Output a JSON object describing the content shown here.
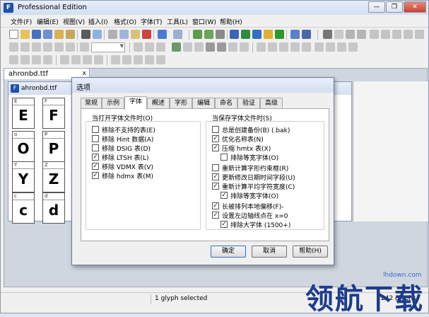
{
  "app": {
    "title": "Professional Edition",
    "icon_letter": "F"
  },
  "window_controls": {
    "minimize": "—",
    "restore": "❐",
    "close": "✕"
  },
  "menu": [
    "文件(F)",
    "编辑(E)",
    "视图(V)",
    "插入(I)",
    "格式(O)",
    "字体(T)",
    "工具(L)",
    "窗口(W)",
    "帮助(H)"
  ],
  "doc_tab": {
    "label": "ahronbd.ttf",
    "close": "x"
  },
  "font_window": {
    "title": "ahronbd.ttf"
  },
  "glyphs": [
    {
      "label": "E",
      "glyph": "E"
    },
    {
      "label": "F",
      "glyph": "F"
    },
    {
      "label": "o",
      "glyph": "O"
    },
    {
      "label": "P",
      "glyph": "P"
    },
    {
      "label": "Y",
      "glyph": "Y"
    },
    {
      "label": "Z",
      "glyph": "Z"
    },
    {
      "label": "c",
      "glyph": "c"
    },
    {
      "label": "d",
      "glyph": "d"
    }
  ],
  "dialog": {
    "title": "选项",
    "tabs": [
      "常规",
      "示例",
      "字体",
      "概述",
      "字形",
      "编辑",
      "命名",
      "验证",
      "高级"
    ],
    "active_tab": "字体",
    "open_group": {
      "label": "当打开字体文件时(",
      "key": "O",
      "label_end": ")",
      "options": [
        {
          "label": "移除不支持的表(E)",
          "checked": false
        },
        {
          "label": "移除 Hint 数据(A)",
          "checked": false
        },
        {
          "label": "移除 DSIG 表(D)",
          "checked": false
        },
        {
          "label": "移除 LTSH 表(L)",
          "checked": true
        },
        {
          "label": "移除 VDMX 表(V)",
          "checked": true
        },
        {
          "label": "移除 hdmx 表(M)",
          "checked": true
        }
      ]
    },
    "save_group": {
      "label": "当保存字体文件时(",
      "key": "S",
      "label_end": ")",
      "options": [
        {
          "label": "总是创建备份(B) (.bak)",
          "checked": false,
          "indent": false
        },
        {
          "label": "优化名称表(N)",
          "checked": true,
          "indent": false
        },
        {
          "label": "压缩 hmtx 表(X)",
          "checked": true,
          "indent": false
        },
        {
          "label": "排除等宽字体(O)",
          "checked": false,
          "indent": true
        },
        {
          "label": "重新计算字形约束框(R)",
          "checked": false,
          "indent": false
        },
        {
          "label": "更新修改日期时间字段(U)",
          "checked": true,
          "indent": false
        },
        {
          "label": "重新计算平均字符宽度(C)",
          "checked": true,
          "indent": false
        },
        {
          "label": "排除等宽字体(O)",
          "checked": true,
          "indent": true
        },
        {
          "label": "长被排列本地偏移(F)-",
          "checked": true,
          "indent": false
        },
        {
          "label": "设置左边轴线点在 x=0",
          "checked": true,
          "indent": false
        },
        {
          "label": "排除大字体 (1500+)",
          "checked": true,
          "indent": true
        }
      ]
    },
    "buttons": {
      "ok": "确定",
      "cancel": "取消",
      "help": "帮助(H)"
    }
  },
  "status": {
    "selection": "1 glyph selected",
    "count": "242 glyphs"
  },
  "watermark": {
    "text": "领航下载",
    "site": "lhdown.com"
  }
}
